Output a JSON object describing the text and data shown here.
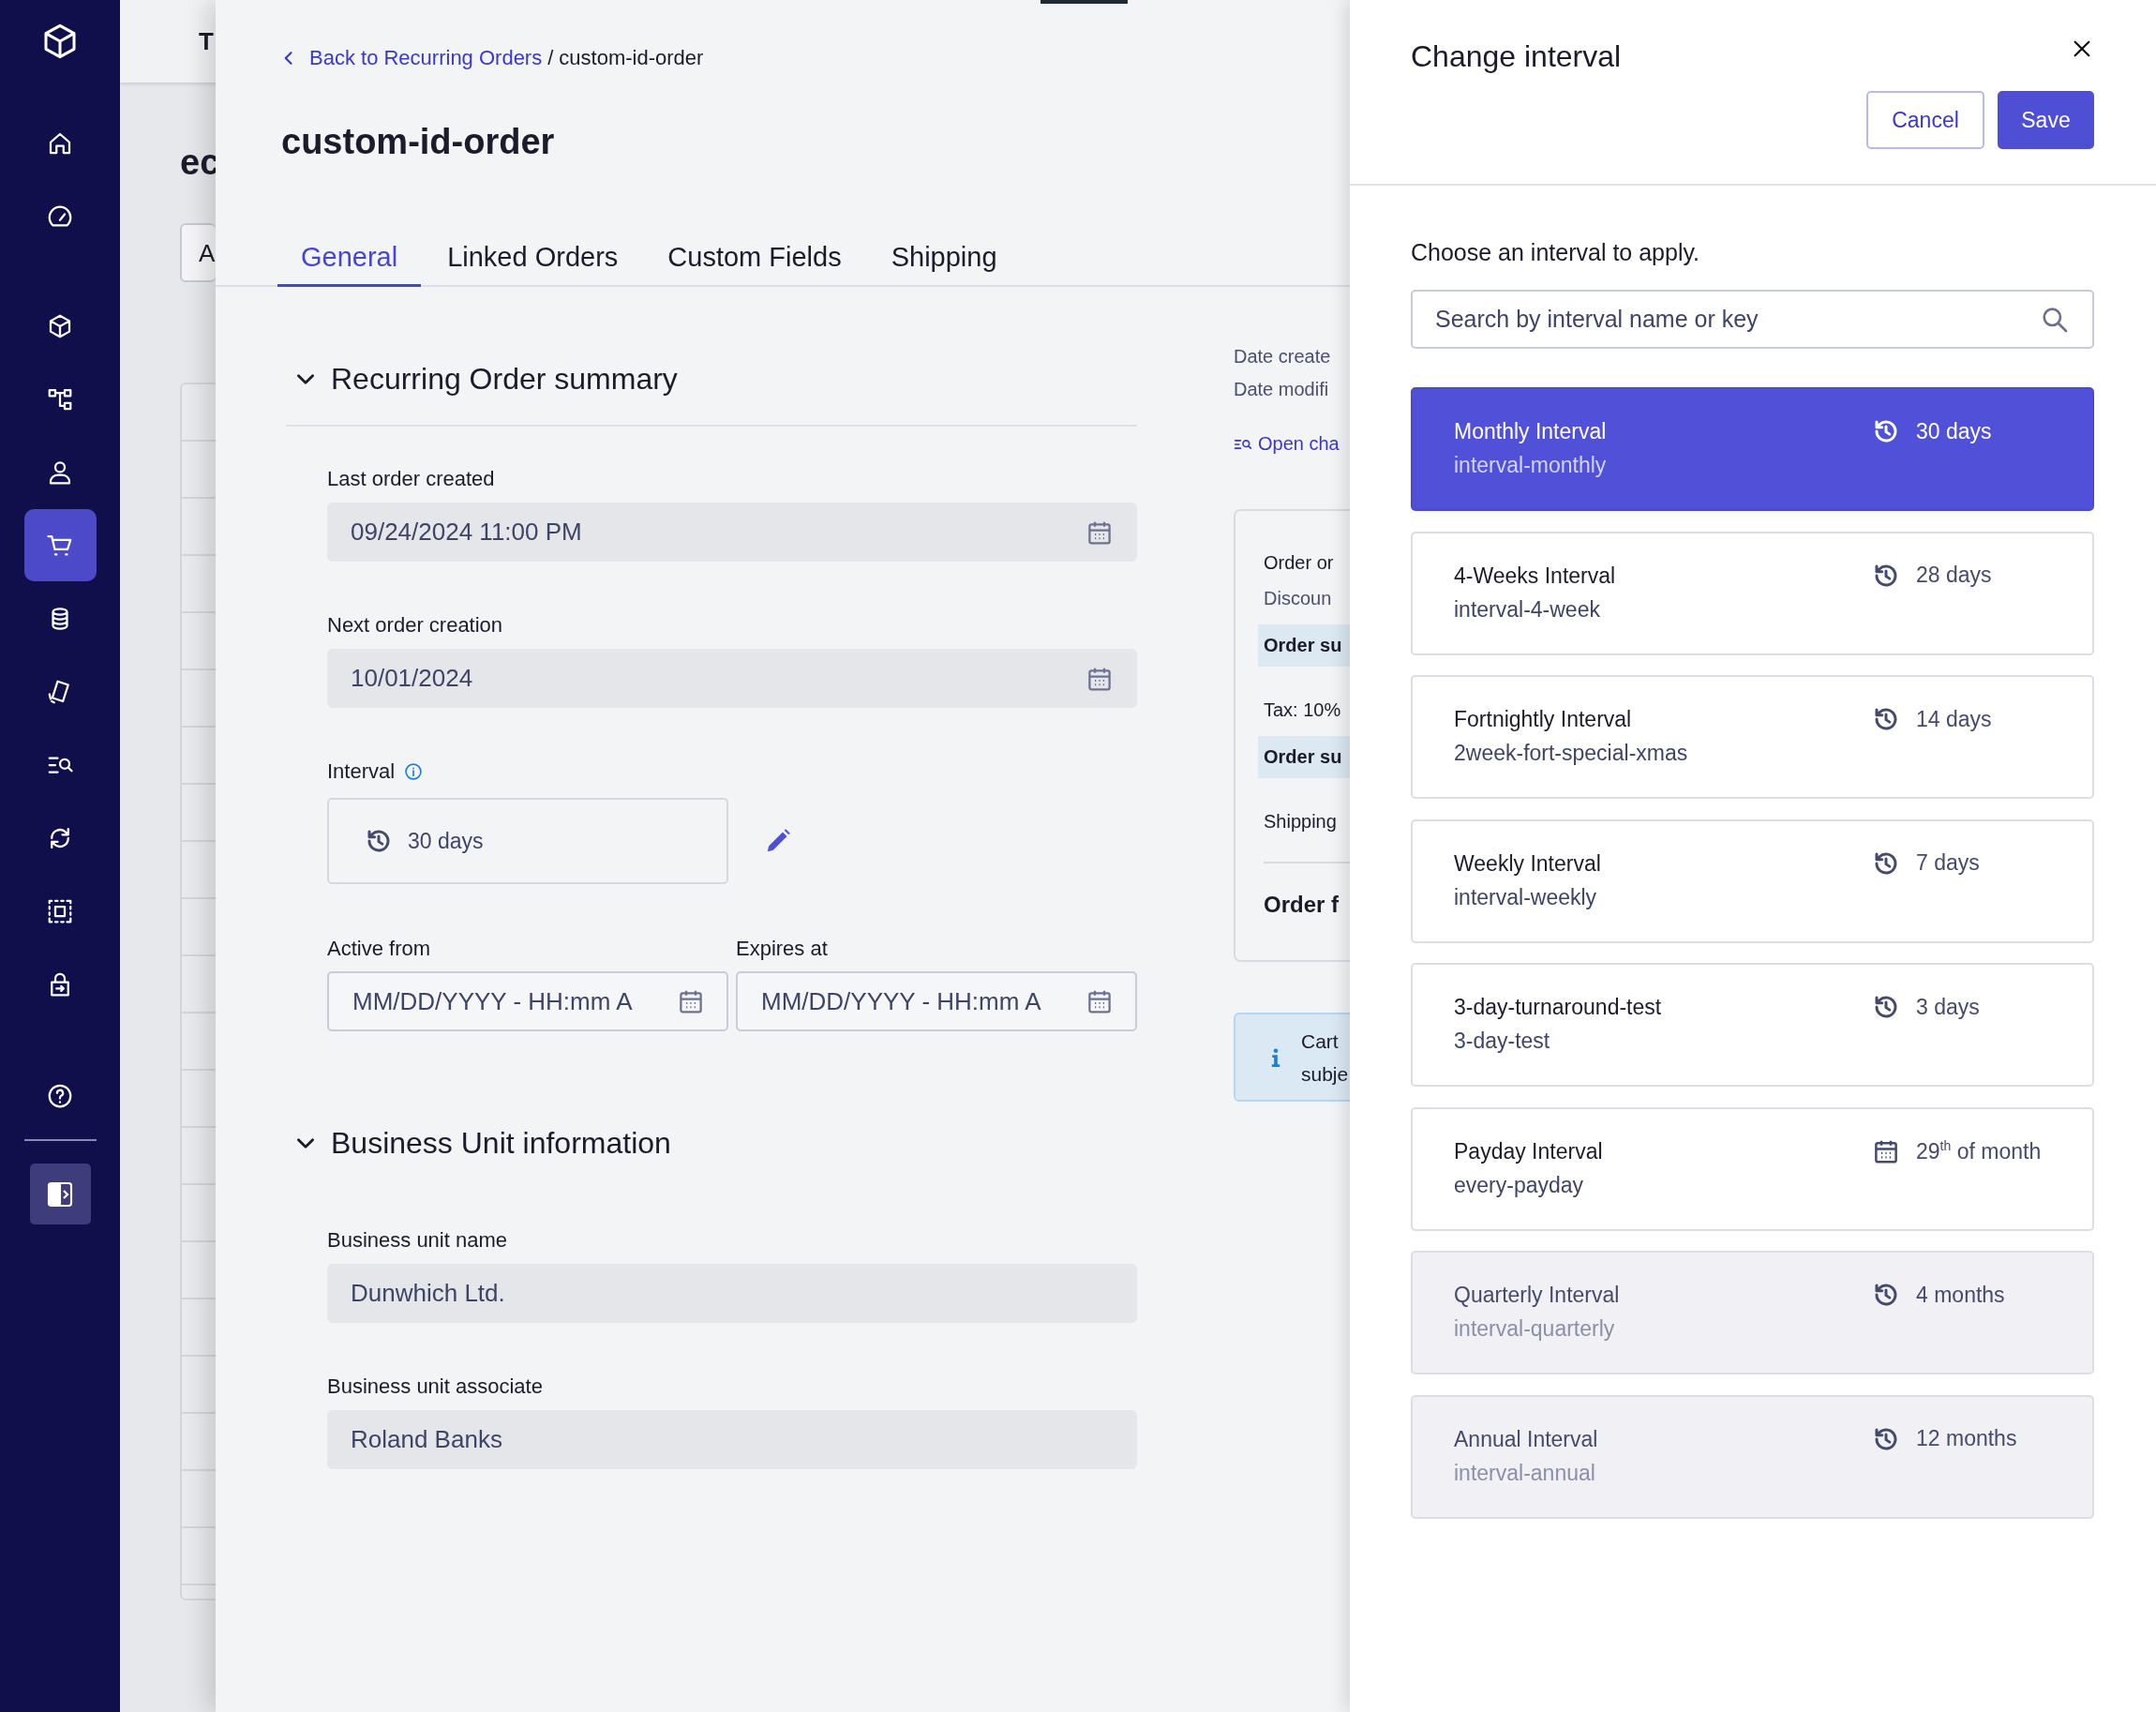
{
  "sidebar": {
    "nav_groups": [
      {
        "items": [
          {
            "selected": false
          },
          {
            "selected": false
          }
        ]
      },
      {
        "items": [
          {
            "selected": false
          },
          {
            "selected": false
          },
          {
            "selected": false
          },
          {
            "selected": true
          },
          {
            "selected": false
          },
          {
            "selected": false
          },
          {
            "selected": false
          },
          {
            "selected": false
          },
          {
            "selected": false
          },
          {
            "selected": false
          }
        ]
      }
    ]
  },
  "background_page": {
    "tab": "T",
    "heading": "ec",
    "field_value": "A"
  },
  "breadcrumb": {
    "link": "Back to Recurring Orders",
    "separator": "/",
    "current": "custom-id-order"
  },
  "title": "custom-id-order",
  "tabs": [
    {
      "label": "General",
      "selected": true
    },
    {
      "label": "Linked Orders",
      "selected": false
    },
    {
      "label": "Custom Fields",
      "selected": false
    },
    {
      "label": "Shipping",
      "selected": false
    }
  ],
  "summary": {
    "title": "Recurring Order summary",
    "expanded": true,
    "last_order": {
      "label": "Last order created",
      "value": "09/24/2024 11:00 PM"
    },
    "next_order": {
      "label": "Next order creation",
      "value": "10/01/2024"
    },
    "interval": {
      "label": "Interval",
      "value": "30 days"
    },
    "active_from": {
      "label": "Active from",
      "placeholder": "MM/DD/YYYY - HH:mm A"
    },
    "expires_at": {
      "label": "Expires at",
      "placeholder": "MM/DD/YYYY - HH:mm A"
    }
  },
  "business_unit": {
    "title": "Business Unit information",
    "expanded": true,
    "fields": [
      {
        "label": "Business unit name",
        "value": "Dunwhich Ltd."
      },
      {
        "label": "Business unit associate",
        "value": "Roland Banks"
      }
    ]
  },
  "details": {
    "dates": [
      "Date create",
      "Date modifi"
    ],
    "changes_link": "Open cha",
    "totals": [
      {
        "text": "Order or",
        "kind": "plain"
      },
      {
        "text": "Discoun",
        "kind": "muted"
      },
      {
        "text": "Order su",
        "kind": "highlight"
      },
      {
        "text": "Tax: 10%",
        "kind": "plain"
      },
      {
        "text": "Order su",
        "kind": "highlight"
      },
      {
        "text": "Shipping",
        "kind": "plain"
      },
      {
        "text": "Order f",
        "kind": "total"
      }
    ],
    "notice": [
      "Cart",
      "subje"
    ]
  },
  "drawer": {
    "title": "Change interval",
    "cancel": "Cancel",
    "save": "Save",
    "prompt": "Choose an interval to apply.",
    "search_placeholder": "Search by interval name or key",
    "intervals": [
      {
        "name": "Monthly Interval",
        "key": "interval-monthly",
        "value": "30 days",
        "kind": "recurring",
        "selected": true,
        "disabled": false
      },
      {
        "name": "4-Weeks Interval",
        "key": "interval-4-week",
        "value": "28 days",
        "kind": "recurring",
        "selected": false,
        "disabled": false
      },
      {
        "name": "Fortnightly Interval",
        "key": "2week-fort-special-xmas",
        "value": "14 days",
        "kind": "recurring",
        "selected": false,
        "disabled": false
      },
      {
        "name": "Weekly Interval",
        "key": "interval-weekly",
        "value": "7 days",
        "kind": "recurring",
        "selected": false,
        "disabled": false
      },
      {
        "name": "3-day-turnaround-test",
        "key": "3-day-test",
        "value": "3 days",
        "kind": "recurring",
        "selected": false,
        "disabled": false
      },
      {
        "name": "Payday Interval",
        "key": "every-payday",
        "value": "29$^{th}$ of month",
        "kind": "calendar",
        "selected": false,
        "disabled": false
      },
      {
        "name": "Quarterly Interval",
        "key": "interval-quarterly",
        "value": "4 months",
        "kind": "recurring",
        "selected": false,
        "disabled": true
      },
      {
        "name": "Annual Interval",
        "key": "interval-annual",
        "value": "12 months",
        "kind": "recurring",
        "selected": false,
        "disabled": true
      }
    ]
  }
}
